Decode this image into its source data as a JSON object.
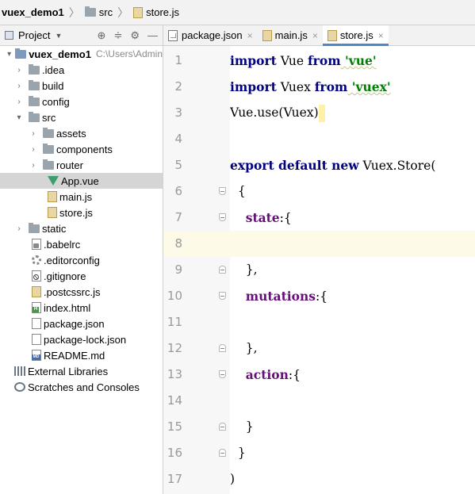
{
  "breadcrumb": {
    "project": "vuex_demo1",
    "folder": "src",
    "file": "store.js"
  },
  "project_panel": {
    "title": "Project",
    "dropdown_icon": "chevron-down-icon"
  },
  "tabs": [
    {
      "label": "package.json",
      "close": "×"
    },
    {
      "label": "main.js",
      "close": "×"
    },
    {
      "label": "store.js",
      "close": "×"
    }
  ],
  "tree": {
    "root": {
      "name": "vuex_demo1",
      "path": "C:\\Users\\Admin"
    },
    "idea": ".idea",
    "build": "build",
    "config": "config",
    "src": "src",
    "assets": "assets",
    "components": "components",
    "router": "router",
    "app_vue": "App.vue",
    "main_js": "main.js",
    "store_js": "store.js",
    "static": "static",
    "babelrc": ".babelrc",
    "editorconfig": ".editorconfig",
    "gitignore": ".gitignore",
    "postcssrc": ".postcssrc.js",
    "index_html": "index.html",
    "package_json": "package.json",
    "package_lock": "package-lock.json",
    "readme": "README.md",
    "external_libs": "External Libraries",
    "scratches": "Scratches and Consoles"
  },
  "editor": {
    "line_numbers": [
      "1",
      "2",
      "3",
      "4",
      "5",
      "6",
      "7",
      "8",
      "9",
      "10",
      "11",
      "12",
      "13",
      "14",
      "15",
      "16",
      "17"
    ],
    "line1": {
      "kw1": "import",
      "id": " Vue ",
      "kw2": "from",
      "str": " 'vue'"
    },
    "line2": {
      "kw1": "import",
      "id": " Vuex ",
      "kw2": "from",
      "str": " 'vuex'"
    },
    "line3": {
      "obj": "Vue.",
      "method": "use",
      "args": "(Vuex)"
    },
    "line5": {
      "kw": "export default new",
      "rest": " Vuex.Store("
    },
    "line6": "{",
    "line7": {
      "field": "state",
      "rest": ":{"
    },
    "line9": "},",
    "line10": {
      "field": "mutations",
      "rest": ":{"
    },
    "line12": "},",
    "line13": {
      "field": "action",
      "rest": ":{"
    },
    "line15": "}",
    "line16": "}",
    "line17": ")"
  }
}
